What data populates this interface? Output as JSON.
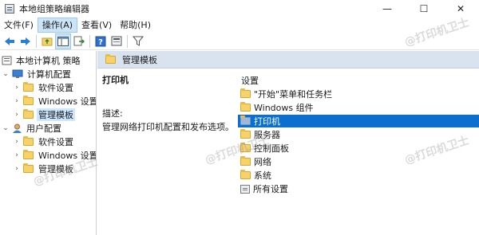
{
  "window": {
    "title": "本地组策略编辑器",
    "controls": {
      "minimize": "—",
      "maximize": "☐",
      "close": "✕"
    }
  },
  "menu": [
    {
      "label": "文件(F)",
      "active": false
    },
    {
      "label": "操作(A)",
      "active": true
    },
    {
      "label": "查看(V)",
      "active": false
    },
    {
      "label": "帮助(H)",
      "active": false
    }
  ],
  "toolbar": {
    "buttons": [
      {
        "icon": "back-arrow-icon"
      },
      {
        "icon": "forward-arrow-icon"
      },
      {
        "icon": "up-folder-icon"
      },
      {
        "icon": "show-hide-tree-icon"
      },
      {
        "icon": "export-list-icon"
      },
      {
        "icon": "help-icon"
      },
      {
        "icon": "properties-icon"
      },
      {
        "icon": "filter-icon"
      }
    ]
  },
  "tree": {
    "root": "本地计算机 策略",
    "computer_config": "计算机配置",
    "computer_children": [
      "软件设置",
      "Windows 设置",
      "管理模板"
    ],
    "user_config": "用户配置",
    "user_children": [
      "软件设置",
      "Windows 设置",
      "管理模板"
    ]
  },
  "right": {
    "header": "管理模板",
    "description_title": "打印机",
    "description_label": "描述:",
    "description_text": "管理网络打印机配置和发布选项。",
    "list_header": "设置",
    "items": [
      {
        "label": "\"开始\"菜单和任务栏",
        "icon": "folder-icon"
      },
      {
        "label": "Windows 组件",
        "icon": "folder-icon"
      },
      {
        "label": "打印机",
        "icon": "folder-icon",
        "selected": true
      },
      {
        "label": "服务器",
        "icon": "folder-icon"
      },
      {
        "label": "控制面板",
        "icon": "folder-icon"
      },
      {
        "label": "网络",
        "icon": "folder-icon"
      },
      {
        "label": "系统",
        "icon": "folder-icon"
      },
      {
        "label": "所有设置",
        "icon": "settings-page-icon"
      }
    ]
  },
  "watermark": "@打印机卫士",
  "colors": {
    "selection": "#0b6fd0",
    "header_bg": "#d9e3f0",
    "menu_active": "#cce4f7"
  }
}
